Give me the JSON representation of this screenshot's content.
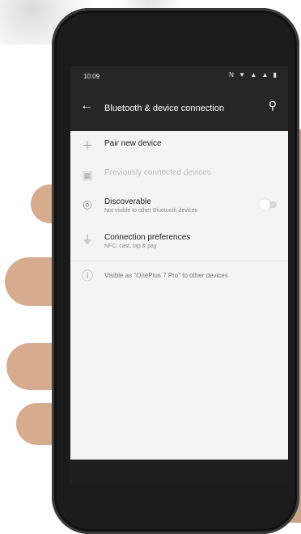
{
  "status_bar": {
    "time": "10:09",
    "icons": "N ▼ ▲ ▲ ▮"
  },
  "app_bar": {
    "title": "Bluetooth & device connection"
  },
  "items": [
    {
      "label": "Pair new device",
      "sub": "",
      "icon": "plus-icon",
      "dim": false
    },
    {
      "label": "Previously connected devices",
      "sub": "",
      "icon": "devices-icon",
      "dim": true
    },
    {
      "label": "Discoverable",
      "sub": "Not visible to other Bluetooth devices",
      "icon": "discoverable-icon",
      "dim": false,
      "toggle": false
    },
    {
      "label": "Connection preferences",
      "sub": "NFC, cast, tap & pay",
      "icon": "connection-preferences-icon",
      "dim": false
    },
    {
      "label": "Visible as \"OnePlus 7 Pro\" to other devices",
      "sub": "",
      "icon": "info-icon",
      "dim": false
    }
  ],
  "colors": {
    "bar": "#262626",
    "screen_bg": "#f4f4f4",
    "text": "#212121",
    "sub_text": "#8d8d8d"
  }
}
